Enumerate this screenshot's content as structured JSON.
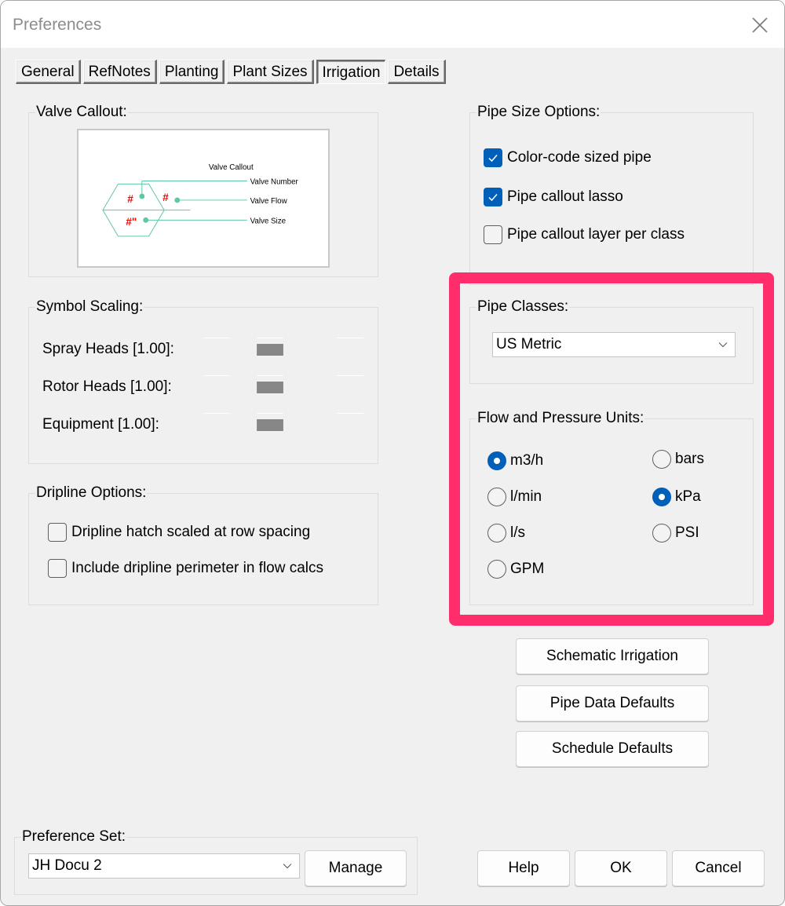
{
  "window": {
    "title": "Preferences",
    "close_icon": "close-icon"
  },
  "tabs": [
    {
      "label": "General",
      "active": false
    },
    {
      "label": "RefNotes",
      "active": false
    },
    {
      "label": "Planting",
      "active": false
    },
    {
      "label": "Plant Sizes",
      "active": false
    },
    {
      "label": "Irrigation",
      "active": true
    },
    {
      "label": "Details",
      "active": false
    }
  ],
  "valve_callout": {
    "label": "Valve Callout:",
    "preview": {
      "title": "Valve Callout",
      "labels": [
        "Valve Number",
        "Valve Flow",
        "Valve Size"
      ],
      "placeholders": [
        "#",
        "#",
        "#\""
      ],
      "line_color": "#5ec7a6",
      "placeholder_color": "#ff0000"
    }
  },
  "symbol_scaling": {
    "label": "Symbol Scaling:",
    "rows": [
      {
        "label": "Spray Heads [1.00]:"
      },
      {
        "label": "Rotor Heads [1.00]:"
      },
      {
        "label": "Equipment [1.00]:"
      }
    ]
  },
  "dripline_options": {
    "label": "Dripline Options:",
    "items": [
      {
        "label": "Dripline hatch scaled at row spacing",
        "checked": false
      },
      {
        "label": "Include dripline perimeter in flow calcs",
        "checked": false
      }
    ]
  },
  "pipe_size_options": {
    "label": "Pipe Size Options:",
    "items": [
      {
        "label": "Color-code sized pipe",
        "checked": true
      },
      {
        "label": "Pipe callout lasso",
        "checked": true
      },
      {
        "label": "Pipe callout layer per class",
        "checked": false
      }
    ]
  },
  "pipe_classes": {
    "label": "Pipe Classes:",
    "selected": "US Metric"
  },
  "flow_pressure_units": {
    "label": "Flow and Pressure Units:",
    "flow": [
      {
        "label": "m3/h",
        "checked": true
      },
      {
        "label": "l/min",
        "checked": false
      },
      {
        "label": "l/s",
        "checked": false
      },
      {
        "label": "GPM",
        "checked": false
      }
    ],
    "pressure": [
      {
        "label": "bars",
        "checked": false
      },
      {
        "label": "kPa",
        "checked": true
      },
      {
        "label": "PSI",
        "checked": false
      }
    ]
  },
  "actions": {
    "schematic_irrigation": "Schematic Irrigation",
    "pipe_data_defaults": "Pipe Data Defaults",
    "schedule_defaults": "Schedule Defaults"
  },
  "preference_set": {
    "label": "Preference Set:",
    "selected": "JH Docu 2",
    "manage_label": "Manage"
  },
  "footer": {
    "help": "Help",
    "ok": "OK",
    "cancel": "Cancel"
  },
  "colors": {
    "accent": "#005fb8",
    "highlight": "#ff2d6b"
  }
}
